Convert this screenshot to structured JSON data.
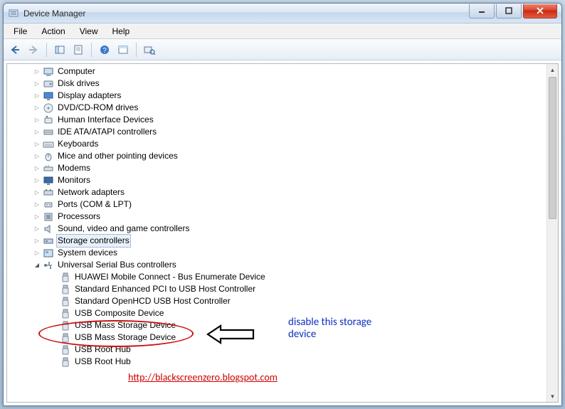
{
  "window": {
    "title": "Device Manager"
  },
  "menu": {
    "file": "File",
    "action": "Action",
    "view": "View",
    "help": "Help"
  },
  "toolbar_icons": {
    "back": "arrow-left-icon",
    "forward": "arrow-right-icon",
    "show_hidden": "show-hidden-icon",
    "properties_sheet": "properties-sheet-icon",
    "help": "help-icon",
    "refresh": "refresh-like-icon",
    "scan": "scan-hardware-icon"
  },
  "categories": [
    {
      "label": "Computer",
      "expanded": false
    },
    {
      "label": "Disk drives",
      "expanded": false
    },
    {
      "label": "Display adapters",
      "expanded": false
    },
    {
      "label": "DVD/CD-ROM drives",
      "expanded": false
    },
    {
      "label": "Human Interface Devices",
      "expanded": false
    },
    {
      "label": "IDE ATA/ATAPI controllers",
      "expanded": false
    },
    {
      "label": "Keyboards",
      "expanded": false
    },
    {
      "label": "Mice and other pointing devices",
      "expanded": false
    },
    {
      "label": "Modems",
      "expanded": false
    },
    {
      "label": "Monitors",
      "expanded": false
    },
    {
      "label": "Network adapters",
      "expanded": false
    },
    {
      "label": "Ports (COM & LPT)",
      "expanded": false
    },
    {
      "label": "Processors",
      "expanded": false
    },
    {
      "label": "Sound, video and game controllers",
      "expanded": false
    },
    {
      "label": "Storage controllers",
      "expanded": false,
      "selected": true
    },
    {
      "label": "System devices",
      "expanded": false
    },
    {
      "label": "Universal Serial Bus controllers",
      "expanded": true,
      "children": [
        "HUAWEI Mobile Connect - Bus Enumerate Device",
        "Standard Enhanced PCI to USB Host Controller",
        "Standard OpenHCD USB Host Controller",
        "USB Composite Device",
        "USB Mass Storage Device",
        "USB Mass Storage Device",
        "USB Root Hub",
        "USB Root Hub"
      ]
    }
  ],
  "annotations": {
    "callout": "disable this storage device",
    "url": "http://blackscreenzero.blogspot.com"
  }
}
